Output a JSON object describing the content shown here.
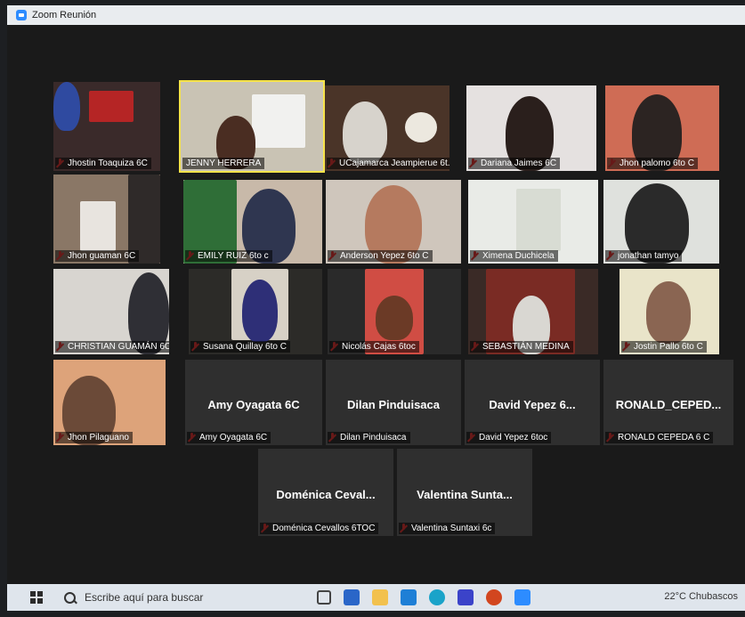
{
  "window": {
    "title": "Zoom Reunión"
  },
  "participants": [
    {
      "name": "Jhostin Toaquiza 6C",
      "muted": true,
      "video": true
    },
    {
      "name": "JENNY HERRERA",
      "muted": false,
      "video": true,
      "active_speaker": true
    },
    {
      "name": "UCajamarca Jeampierue 6t...",
      "muted": true,
      "video": true
    },
    {
      "name": "Dariana Jaimes 6C",
      "muted": true,
      "video": true
    },
    {
      "name": "Jhon palomo 6to C",
      "muted": true,
      "video": true
    },
    {
      "name": "Jhon guaman 6C",
      "muted": true,
      "video": true
    },
    {
      "name": "EMILY RUIZ 6to c",
      "muted": true,
      "video": true
    },
    {
      "name": "Anderson Yepez 6to C",
      "muted": true,
      "video": true
    },
    {
      "name": "Ximena Duchicela",
      "muted": true,
      "video": true
    },
    {
      "name": "jonathan tamyo",
      "muted": true,
      "video": true
    },
    {
      "name": "CHRISTIAN GUAMÁN 6C",
      "muted": true,
      "video": true
    },
    {
      "name": "Susana Quillay 6to C",
      "muted": true,
      "video": true
    },
    {
      "name": "Nicolás Cajas 6toc",
      "muted": true,
      "video": true
    },
    {
      "name": "SEBASTIÁN MEDINA",
      "muted": true,
      "video": true
    },
    {
      "name": "Jostin Pallo 6to C",
      "muted": true,
      "video": true
    },
    {
      "name": "Jhon Pilaguano",
      "muted": true,
      "video": true
    },
    {
      "name": "Amy Oyagata 6C",
      "display": "Amy Oyagata 6C",
      "muted": true,
      "video": false
    },
    {
      "name": "Dilan Pinduisaca",
      "display": "Dilan Pinduisaca",
      "muted": true,
      "video": false
    },
    {
      "name": "David Yepez 6toc",
      "display": "David Yepez 6...",
      "muted": true,
      "video": false
    },
    {
      "name": "RONALD CEPEDA 6 C",
      "display": "RONALD_CEPED...",
      "muted": true,
      "video": false
    },
    {
      "name": "Doménica Cevallos 6TOC",
      "display": "Doménica Ceval...",
      "muted": true,
      "video": false
    },
    {
      "name": "Valentina Suntaxi 6c",
      "display": "Valentina Sunta...",
      "muted": true,
      "video": false
    }
  ],
  "taskbar": {
    "search_placeholder": "Escribe aquí para buscar",
    "weather": "22°C Chubascos"
  }
}
